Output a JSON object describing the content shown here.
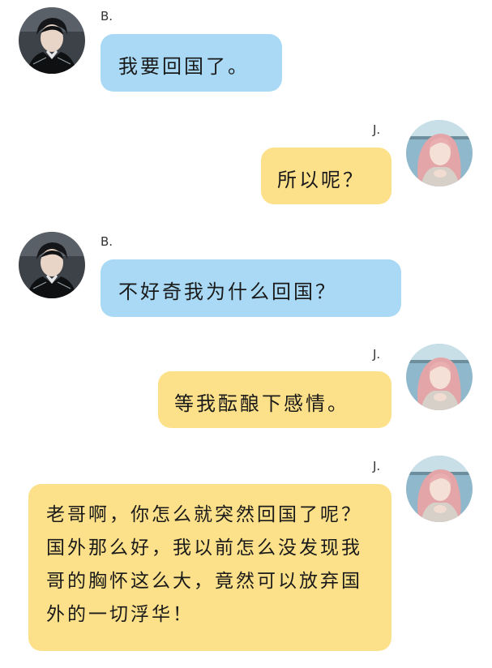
{
  "colors": {
    "left_bubble": "#a9d9f5",
    "right_bubble": "#fde18a",
    "background": "#ffffff"
  },
  "messages": [
    {
      "sender": "B.",
      "side": "left",
      "text": "我要回国了。",
      "avatar_icon": "boy-avatar-icon"
    },
    {
      "sender": "J.",
      "side": "right",
      "text": "所以呢？",
      "avatar_icon": "girl-avatar-icon"
    },
    {
      "sender": "B.",
      "side": "left",
      "text": "不好奇我为什么回国？",
      "avatar_icon": "boy-avatar-icon"
    },
    {
      "sender": "J.",
      "side": "right",
      "text": "等我酝酿下感情。",
      "avatar_icon": "girl-avatar-icon"
    },
    {
      "sender": "J.",
      "side": "right",
      "text": "老哥啊，你怎么就突然回国了呢？国外那么好，我以前怎么没发现我哥的胸怀这么大，竟然可以放弃国外的一切浮华！",
      "avatar_icon": "girl-avatar-icon"
    }
  ]
}
